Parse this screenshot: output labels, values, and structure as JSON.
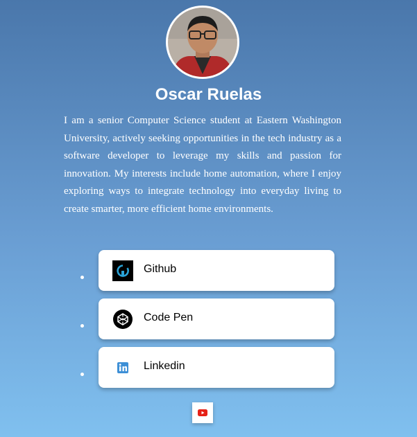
{
  "profile": {
    "name": "Oscar Ruelas",
    "bio": "I am a senior Computer Science student at Eastern Washington University, actively seeking opportunities in the tech industry as a software developer to leverage my skills and passion for innovation. My interests include home automation, where I enjoy exploring ways to integrate technology into everyday living to create smarter, more efficient home environments."
  },
  "links": [
    {
      "label": "Github",
      "icon": "github-icon"
    },
    {
      "label": "Code Pen",
      "icon": "codepen-icon"
    },
    {
      "label": "Linkedin",
      "icon": "linkedin-icon"
    }
  ],
  "footer": {
    "icon": "youtube-icon"
  },
  "colors": {
    "background_top": "#4a77ab",
    "background_bottom": "#80c0ef",
    "github_accent": "#2aa3d8",
    "linkedin_blue": "#3d8fd6",
    "youtube_red": "#e62117"
  }
}
